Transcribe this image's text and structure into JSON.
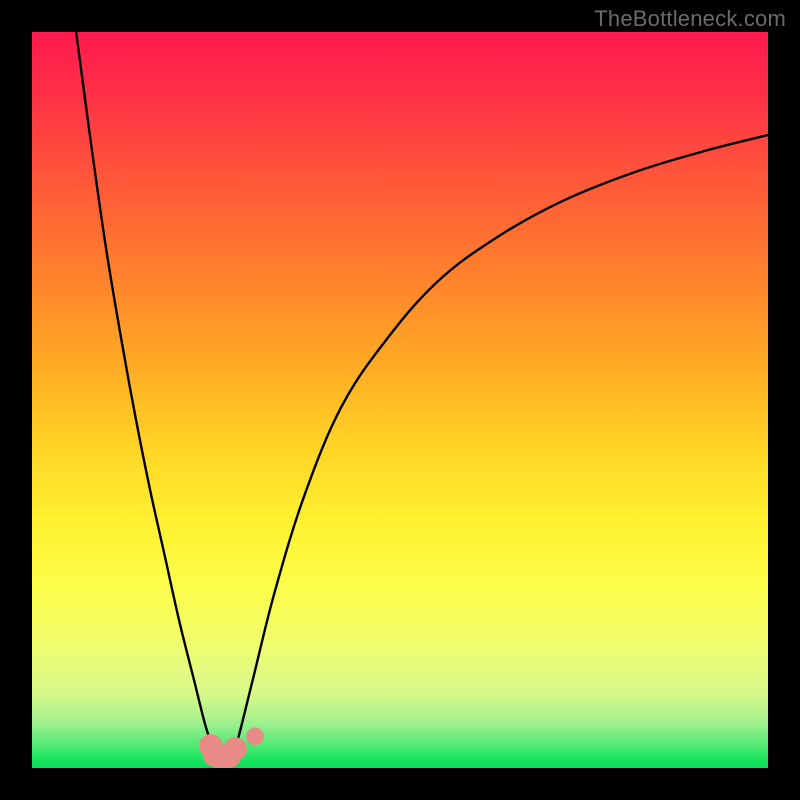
{
  "watermark": {
    "text": "TheBottleneck.com"
  },
  "colors": {
    "frame": "#000000",
    "curve": "#000000",
    "marker": "#e88a86",
    "gradient_stops": [
      "#ff1a4d",
      "#ff2f47",
      "#ff4a3e",
      "#ff6a33",
      "#ff8b2a",
      "#ffae24",
      "#ffd325",
      "#fff02f",
      "#fdfd45",
      "#f6fd5e",
      "#eafc77",
      "#d6f98a",
      "#9ef08e",
      "#4de973",
      "#14e35e",
      "#09de58"
    ]
  },
  "chart_data": {
    "type": "line",
    "title": "",
    "xlabel": "",
    "ylabel": "",
    "xlim": [
      0,
      100
    ],
    "ylim": [
      0,
      100
    ],
    "grid": false,
    "series": [
      {
        "name": "left-curve",
        "x": [
          6,
          8,
          10,
          12,
          14,
          16,
          18,
          20,
          22,
          23.5,
          24.5,
          25.5
        ],
        "y": [
          100,
          85,
          71,
          59,
          48,
          38,
          29,
          20,
          12,
          6,
          3,
          1
        ]
      },
      {
        "name": "right-curve",
        "x": [
          27,
          28,
          30,
          33,
          37,
          42,
          48,
          55,
          63,
          72,
          82,
          92,
          100
        ],
        "y": [
          1,
          4,
          12,
          24,
          37,
          49,
          58,
          66,
          72,
          77,
          81,
          84,
          86
        ]
      }
    ],
    "markers": [
      {
        "name": "marker-bottom-left",
        "x": 24.3,
        "y": 3.0,
        "r": 1.6
      },
      {
        "name": "marker-bottom-mid1",
        "x": 24.8,
        "y": 1.8,
        "r": 1.6
      },
      {
        "name": "marker-bottom-mid2",
        "x": 25.8,
        "y": 1.3,
        "r": 1.6
      },
      {
        "name": "marker-bottom-mid3",
        "x": 26.8,
        "y": 1.6,
        "r": 1.6
      },
      {
        "name": "marker-bottom-mid4",
        "x": 27.6,
        "y": 2.6,
        "r": 1.6
      },
      {
        "name": "marker-bottom-right",
        "x": 30.3,
        "y": 4.3,
        "r": 1.2
      }
    ]
  }
}
